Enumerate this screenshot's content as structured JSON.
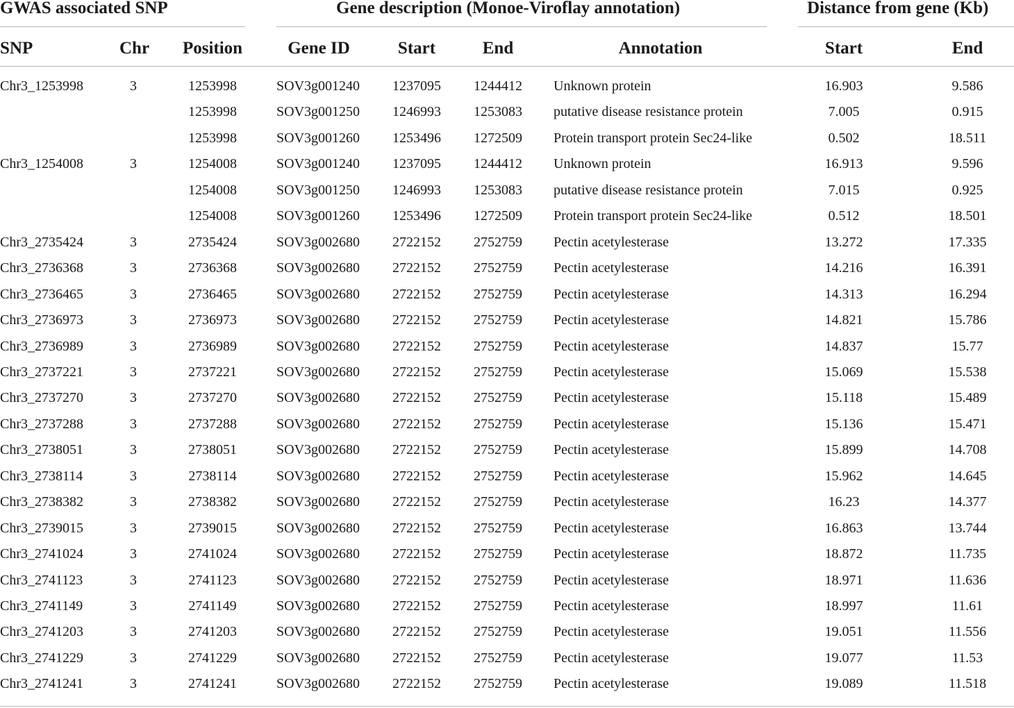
{
  "group_headers": {
    "gwas": "GWAS associated SNP",
    "gene": "Gene description (Monoe-Viroflay annotation)",
    "distance": "Distance from gene (Kb)"
  },
  "columns": {
    "snp": "SNP",
    "chr": "Chr",
    "position": "Position",
    "gene_id": "Gene ID",
    "gene_start": "Start",
    "gene_end": "End",
    "annotation": "Annotation",
    "dist_start": "Start",
    "dist_end": "End"
  },
  "rows": [
    [
      "Chr3_1253998",
      "3",
      "1253998",
      "SOV3g001240",
      "1237095",
      "1244412",
      "Unknown protein",
      "16.903",
      "9.586"
    ],
    [
      "",
      "",
      "1253998",
      "SOV3g001250",
      "1246993",
      "1253083",
      "putative disease resistance protein",
      "7.005",
      "0.915"
    ],
    [
      "",
      "",
      "1253998",
      "SOV3g001260",
      "1253496",
      "1272509",
      "Protein transport protein Sec24-like",
      "0.502",
      "18.511"
    ],
    [
      "Chr3_1254008",
      "3",
      "1254008",
      "SOV3g001240",
      "1237095",
      "1244412",
      "Unknown protein",
      "16.913",
      "9.596"
    ],
    [
      "",
      "",
      "1254008",
      "SOV3g001250",
      "1246993",
      "1253083",
      "putative disease resistance protein",
      "7.015",
      "0.925"
    ],
    [
      "",
      "",
      "1254008",
      "SOV3g001260",
      "1253496",
      "1272509",
      "Protein transport protein Sec24-like",
      "0.512",
      "18.501"
    ],
    [
      "Chr3_2735424",
      "3",
      "2735424",
      "SOV3g002680",
      "2722152",
      "2752759",
      "Pectin acetylesterase",
      "13.272",
      "17.335"
    ],
    [
      "Chr3_2736368",
      "3",
      "2736368",
      "SOV3g002680",
      "2722152",
      "2752759",
      "Pectin acetylesterase",
      "14.216",
      "16.391"
    ],
    [
      "Chr3_2736465",
      "3",
      "2736465",
      "SOV3g002680",
      "2722152",
      "2752759",
      "Pectin acetylesterase",
      "14.313",
      "16.294"
    ],
    [
      "Chr3_2736973",
      "3",
      "2736973",
      "SOV3g002680",
      "2722152",
      "2752759",
      "Pectin acetylesterase",
      "14.821",
      "15.786"
    ],
    [
      "Chr3_2736989",
      "3",
      "2736989",
      "SOV3g002680",
      "2722152",
      "2752759",
      "Pectin acetylesterase",
      "14.837",
      "15.77"
    ],
    [
      "Chr3_2737221",
      "3",
      "2737221",
      "SOV3g002680",
      "2722152",
      "2752759",
      "Pectin acetylesterase",
      "15.069",
      "15.538"
    ],
    [
      "Chr3_2737270",
      "3",
      "2737270",
      "SOV3g002680",
      "2722152",
      "2752759",
      "Pectin acetylesterase",
      "15.118",
      "15.489"
    ],
    [
      "Chr3_2737288",
      "3",
      "2737288",
      "SOV3g002680",
      "2722152",
      "2752759",
      "Pectin acetylesterase",
      "15.136",
      "15.471"
    ],
    [
      "Chr3_2738051",
      "3",
      "2738051",
      "SOV3g002680",
      "2722152",
      "2752759",
      "Pectin acetylesterase",
      "15.899",
      "14.708"
    ],
    [
      "Chr3_2738114",
      "3",
      "2738114",
      "SOV3g002680",
      "2722152",
      "2752759",
      "Pectin acetylesterase",
      "15.962",
      "14.645"
    ],
    [
      "Chr3_2738382",
      "3",
      "2738382",
      "SOV3g002680",
      "2722152",
      "2752759",
      "Pectin acetylesterase",
      "16.23",
      "14.377"
    ],
    [
      "Chr3_2739015",
      "3",
      "2739015",
      "SOV3g002680",
      "2722152",
      "2752759",
      "Pectin acetylesterase",
      "16.863",
      "13.744"
    ],
    [
      "Chr3_2741024",
      "3",
      "2741024",
      "SOV3g002680",
      "2722152",
      "2752759",
      "Pectin acetylesterase",
      "18.872",
      "11.735"
    ],
    [
      "Chr3_2741123",
      "3",
      "2741123",
      "SOV3g002680",
      "2722152",
      "2752759",
      "Pectin acetylesterase",
      "18.971",
      "11.636"
    ],
    [
      "Chr3_2741149",
      "3",
      "2741149",
      "SOV3g002680",
      "2722152",
      "2752759",
      "Pectin acetylesterase",
      "18.997",
      "11.61"
    ],
    [
      "Chr3_2741203",
      "3",
      "2741203",
      "SOV3g002680",
      "2722152",
      "2752759",
      "Pectin acetylesterase",
      "19.051",
      "11.556"
    ],
    [
      "Chr3_2741229",
      "3",
      "2741229",
      "SOV3g002680",
      "2722152",
      "2752759",
      "Pectin acetylesterase",
      "19.077",
      "11.53"
    ],
    [
      "Chr3_2741241",
      "3",
      "2741241",
      "SOV3g002680",
      "2722152",
      "2752759",
      "Pectin acetylesterase",
      "19.089",
      "11.518"
    ]
  ]
}
